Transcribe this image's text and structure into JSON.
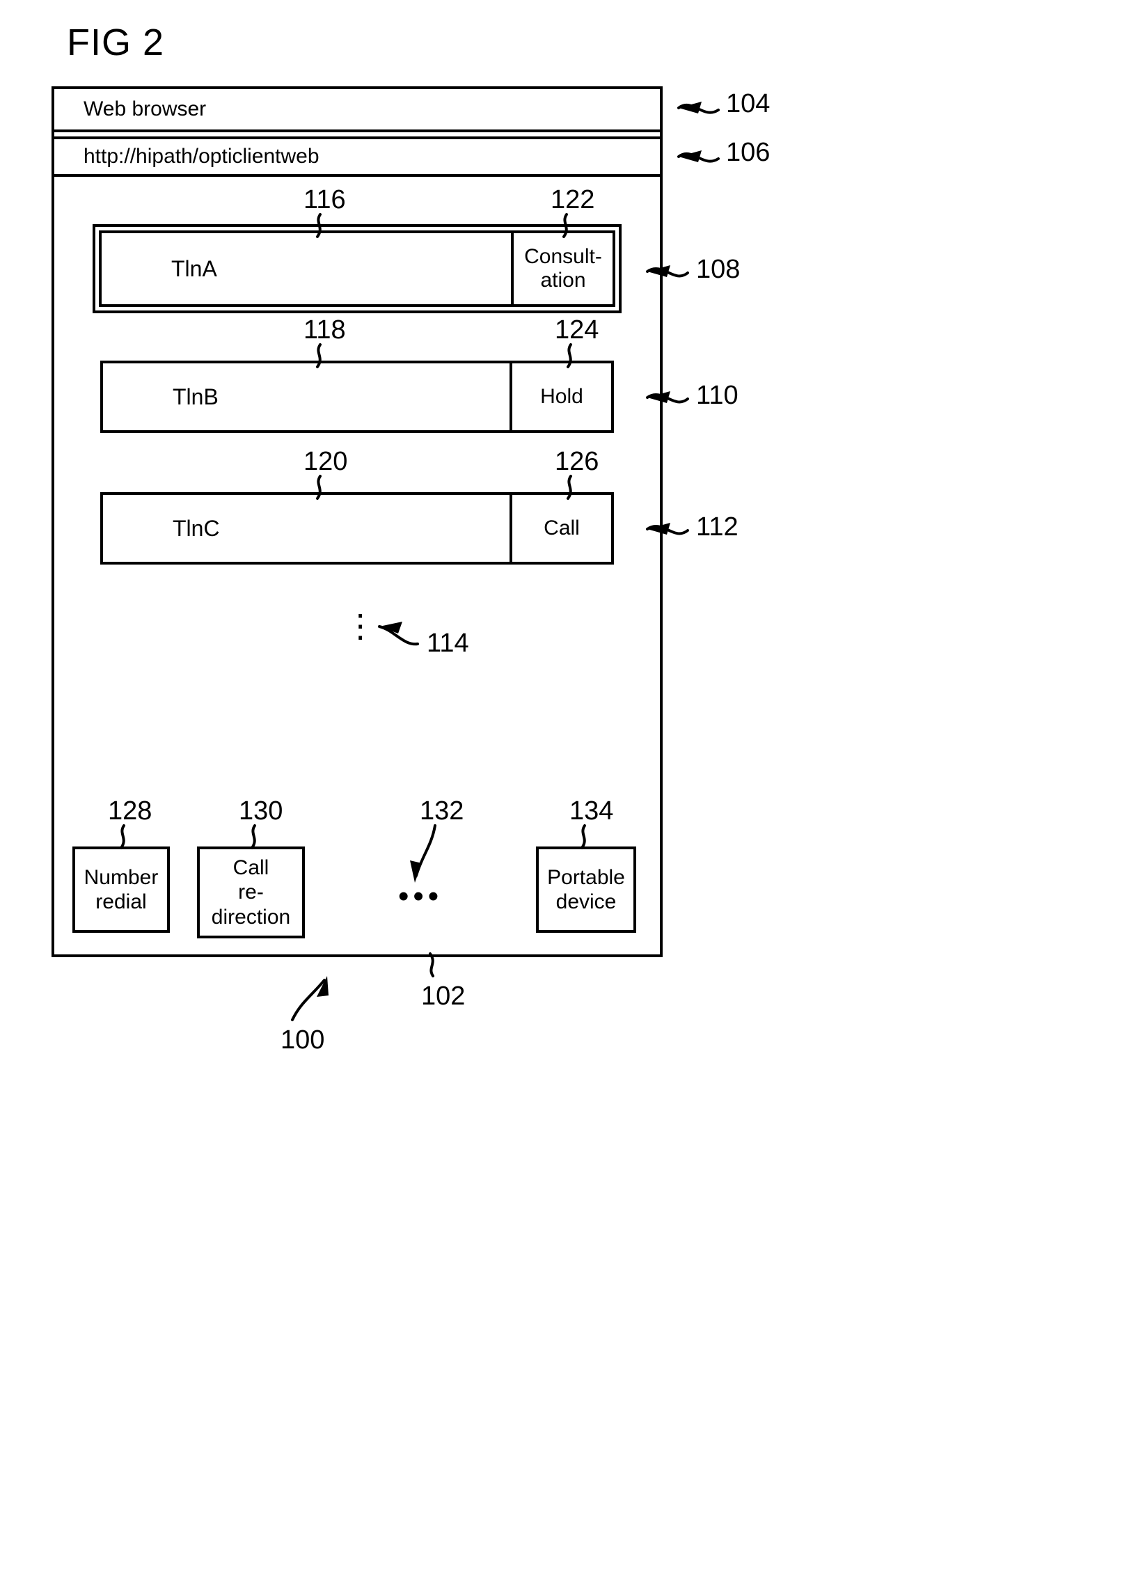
{
  "figure": {
    "title": "FIG 2"
  },
  "browser": {
    "title": "Web browser",
    "url": "http://hipath/opticlientweb"
  },
  "call_rows": [
    {
      "name": "TlnA",
      "action": "Consult-\nation",
      "action_line1": "Consult-",
      "action_line2": "ation",
      "selected": true
    },
    {
      "name": "TlnB",
      "action": "Hold",
      "action_line1": "Hold",
      "action_line2": "",
      "selected": false
    },
    {
      "name": "TlnC",
      "action": "Call",
      "action_line1": "Call",
      "action_line2": "",
      "selected": false
    }
  ],
  "row_continuation": "⋮",
  "feature_buttons": [
    {
      "line1": "Number",
      "line2": "redial",
      "line3": ""
    },
    {
      "line1": "Call",
      "line2": "re-",
      "line3": "direction"
    },
    {
      "line1": "Portable",
      "line2": "device",
      "line3": ""
    }
  ],
  "feature_continuation": "•••",
  "reference_numerals": {
    "window": "100",
    "page_area": "102",
    "browser_titlebar": "104",
    "browser_urlbar": "106",
    "row_a": "108",
    "row_b": "110",
    "row_c": "112",
    "row_ellipsis": "114",
    "name_a": "116",
    "name_b": "118",
    "name_c": "120",
    "action_a": "122",
    "action_b": "124",
    "action_c": "126",
    "btn_number_redial": "128",
    "btn_call_redirection": "130",
    "btn_ellipsis": "132",
    "btn_portable_device": "134"
  }
}
